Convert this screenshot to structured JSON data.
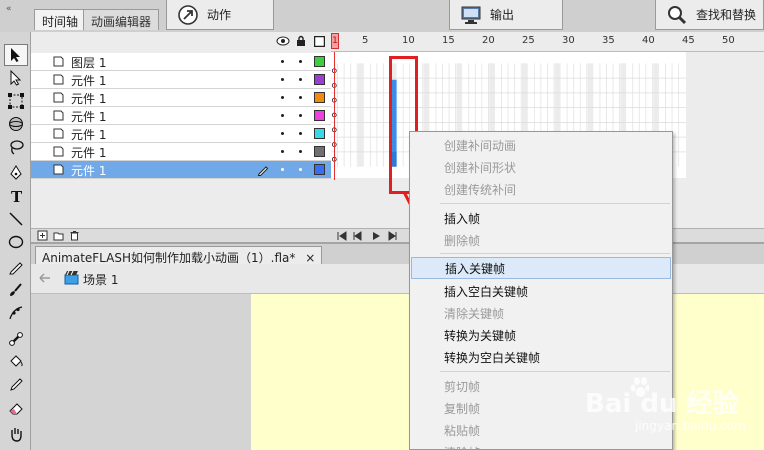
{
  "top_tabs": {
    "collapse": "«",
    "timeline": "时间轴",
    "motion_editor": "动画编辑器",
    "actions": "动作",
    "output": "输出",
    "find_replace": "查找和替换"
  },
  "layers": [
    {
      "name": "图层 1",
      "color": "#3ecf3e"
    },
    {
      "name": "元件 1",
      "color": "#9b3fd0"
    },
    {
      "name": "元件 1",
      "color": "#f08a10"
    },
    {
      "name": "元件 1",
      "color": "#f040e0"
    },
    {
      "name": "元件 1",
      "color": "#38d8e8"
    },
    {
      "name": "元件 1",
      "color": "#707070"
    },
    {
      "name": "元件 1",
      "color": "#3a6ef0",
      "selected": true
    }
  ],
  "ruler": {
    "current": "1",
    "labels": [
      "5",
      "10",
      "15",
      "20",
      "25",
      "30",
      "35",
      "40",
      "45",
      "50"
    ]
  },
  "document": {
    "tab_title": "AnimateFLASH如何制作加载小动画（1）.fla*",
    "close_glyph": "×",
    "scene": "场景 1"
  },
  "context_menu": {
    "items": [
      {
        "label": "创建补间动画",
        "enabled": false
      },
      {
        "label": "创建补间形状",
        "enabled": false
      },
      {
        "label": "创建传统补间",
        "enabled": false
      },
      {
        "sep": true
      },
      {
        "label": "插入帧",
        "enabled": true
      },
      {
        "label": "删除帧",
        "enabled": false
      },
      {
        "sep": true
      },
      {
        "label": "插入关键帧",
        "enabled": true,
        "highlighted": true
      },
      {
        "label": "插入空白关键帧",
        "enabled": true
      },
      {
        "label": "清除关键帧",
        "enabled": false
      },
      {
        "label": "转换为关键帧",
        "enabled": true
      },
      {
        "label": "转换为空白关键帧",
        "enabled": true
      },
      {
        "sep": true
      },
      {
        "label": "剪切帧",
        "enabled": false
      },
      {
        "label": "复制帧",
        "enabled": false
      },
      {
        "label": "粘贴帧",
        "enabled": false
      },
      {
        "label": "清除帧",
        "enabled": false
      }
    ]
  },
  "watermark": {
    "brand": "Bai du 经验",
    "url": "jingyan.baidu.com"
  },
  "colors": {
    "annotation_red": "#e02020",
    "selection_blue": "#71a9e8",
    "keyframe_blue": "#3a8ee8",
    "stage_yellow": "#ffffcc"
  }
}
